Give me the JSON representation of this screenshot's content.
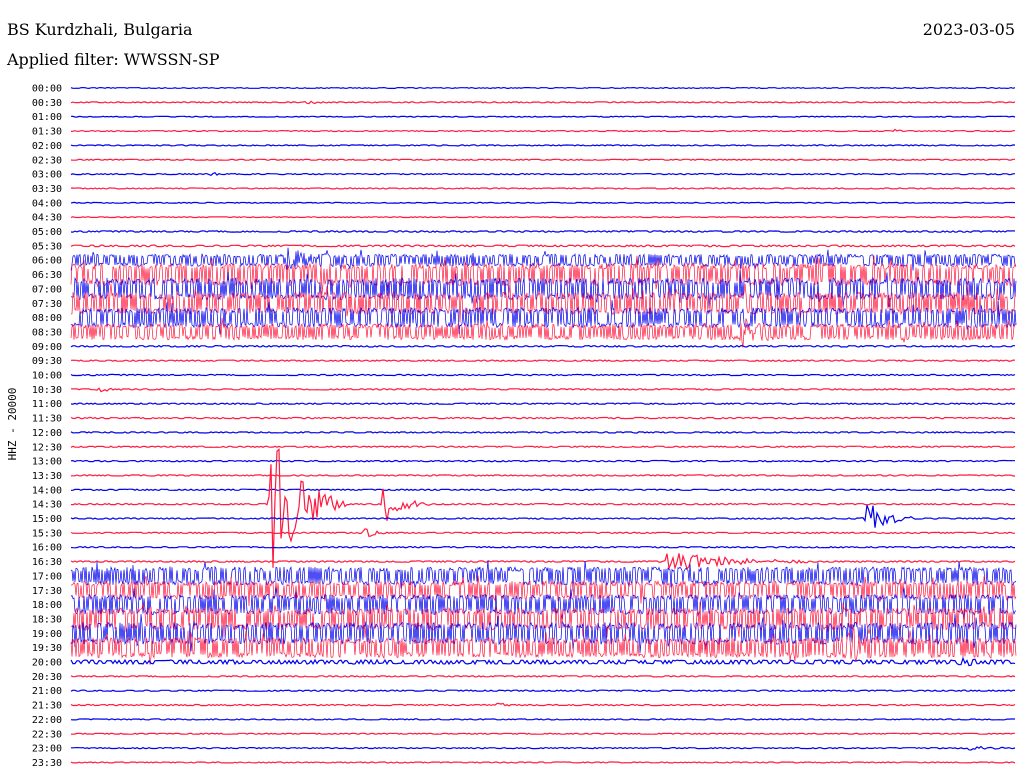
{
  "header": {
    "station": "BS Kurdzhali, Bulgaria",
    "date": "2023-03-05",
    "filter": "Applied filter: WWSSN-SP"
  },
  "colors": {
    "blue": "#0000ee",
    "red": "#ff1a40"
  },
  "chart_data": {
    "type": "line",
    "title": "BS Kurdzhali, Bulgaria",
    "ylabel": "HHZ - 20000",
    "xlabel": "",
    "grid": false,
    "rows": [
      {
        "label": "00:00",
        "color": "blue",
        "noise": 0.4
      },
      {
        "label": "00:30",
        "color": "red",
        "noise": 0.5
      },
      {
        "label": "01:00",
        "color": "blue",
        "noise": 0.4
      },
      {
        "label": "01:30",
        "color": "red",
        "noise": 0.5
      },
      {
        "label": "02:00",
        "color": "blue",
        "noise": 0.5
      },
      {
        "label": "02:30",
        "color": "red",
        "noise": 0.5
      },
      {
        "label": "03:00",
        "color": "blue",
        "noise": 0.5
      },
      {
        "label": "03:30",
        "color": "red",
        "noise": 0.5
      },
      {
        "label": "04:00",
        "color": "blue",
        "noise": 0.4
      },
      {
        "label": "04:30",
        "color": "red",
        "noise": 0.4
      },
      {
        "label": "05:00",
        "color": "blue",
        "noise": 0.7
      },
      {
        "label": "05:30",
        "color": "red",
        "noise": 0.8
      },
      {
        "label": "06:00",
        "color": "blue",
        "noise": 6
      },
      {
        "label": "06:30",
        "color": "red",
        "noise": 11
      },
      {
        "label": "07:00",
        "color": "blue",
        "noise": 11
      },
      {
        "label": "07:30",
        "color": "red",
        "noise": 11
      },
      {
        "label": "08:00",
        "color": "blue",
        "noise": 10
      },
      {
        "label": "08:30",
        "color": "red",
        "noise": 8
      },
      {
        "label": "09:00",
        "color": "blue",
        "noise": 0.7
      },
      {
        "label": "09:30",
        "color": "red",
        "noise": 0.6
      },
      {
        "label": "10:00",
        "color": "blue",
        "noise": 0.6
      },
      {
        "label": "10:30",
        "color": "red",
        "noise": 0.6
      },
      {
        "label": "11:00",
        "color": "blue",
        "noise": 0.6
      },
      {
        "label": "11:30",
        "color": "red",
        "noise": 0.6
      },
      {
        "label": "12:00",
        "color": "blue",
        "noise": 0.6
      },
      {
        "label": "12:30",
        "color": "red",
        "noise": 0.6
      },
      {
        "label": "13:00",
        "color": "blue",
        "noise": 0.6
      },
      {
        "label": "13:30",
        "color": "red",
        "noise": 0.6
      },
      {
        "label": "14:00",
        "color": "blue",
        "noise": 0.6
      },
      {
        "label": "14:30",
        "color": "red",
        "noise": 0.6
      },
      {
        "label": "15:00",
        "color": "blue",
        "noise": 0.6
      },
      {
        "label": "15:30",
        "color": "red",
        "noise": 0.6
      },
      {
        "label": "16:00",
        "color": "blue",
        "noise": 0.6
      },
      {
        "label": "16:30",
        "color": "red",
        "noise": 0.7
      },
      {
        "label": "17:00",
        "color": "blue",
        "noise": 9
      },
      {
        "label": "17:30",
        "color": "red",
        "noise": 9
      },
      {
        "label": "18:00",
        "color": "blue",
        "noise": 10
      },
      {
        "label": "18:30",
        "color": "red",
        "noise": 11
      },
      {
        "label": "19:00",
        "color": "blue",
        "noise": 11
      },
      {
        "label": "19:30",
        "color": "red",
        "noise": 10
      },
      {
        "label": "20:00",
        "color": "blue",
        "noise": 2
      },
      {
        "label": "20:30",
        "color": "red",
        "noise": 0.6
      },
      {
        "label": "21:00",
        "color": "blue",
        "noise": 0.6
      },
      {
        "label": "21:30",
        "color": "red",
        "noise": 0.6
      },
      {
        "label": "22:00",
        "color": "blue",
        "noise": 0.5
      },
      {
        "label": "22:30",
        "color": "red",
        "noise": 0.5
      },
      {
        "label": "23:00",
        "color": "blue",
        "noise": 0.5
      },
      {
        "label": "23:30",
        "color": "red",
        "noise": 0.5
      }
    ],
    "events": [
      {
        "row": 13,
        "t": 0.233,
        "amp": 3,
        "dur": 0.02
      },
      {
        "row": 12,
        "t": 0.228,
        "amp": 12,
        "dur": 0.05
      },
      {
        "row": 29,
        "t": 0.212,
        "amp": 80,
        "dur": 0.08
      },
      {
        "row": 29,
        "t": 0.33,
        "amp": 22,
        "dur": 0.05
      },
      {
        "row": 31,
        "t": 0.31,
        "amp": 8,
        "dur": 0.03
      },
      {
        "row": 30,
        "t": 0.84,
        "amp": 24,
        "dur": 0.05
      },
      {
        "row": 33,
        "t": 0.63,
        "amp": 12,
        "dur": 0.15
      },
      {
        "row": 17,
        "t": 0.71,
        "amp": 14,
        "dur": 0.04
      },
      {
        "row": 39,
        "t": 0.82,
        "amp": 14,
        "dur": 0.05
      },
      {
        "row": 40,
        "t": 0.94,
        "amp": 6,
        "dur": 0.03
      },
      {
        "row": 43,
        "t": 0.45,
        "amp": 3,
        "dur": 0.02
      },
      {
        "row": 6,
        "t": 0.15,
        "amp": 2,
        "dur": 0.03
      },
      {
        "row": 1,
        "t": 0.25,
        "amp": 2,
        "dur": 0.03
      },
      {
        "row": 3,
        "t": 0.87,
        "amp": 3,
        "dur": 0.01
      },
      {
        "row": 21,
        "t": 0.03,
        "amp": 3,
        "dur": 0.03
      },
      {
        "row": 46,
        "t": 0.95,
        "amp": 3,
        "dur": 0.05
      }
    ]
  }
}
